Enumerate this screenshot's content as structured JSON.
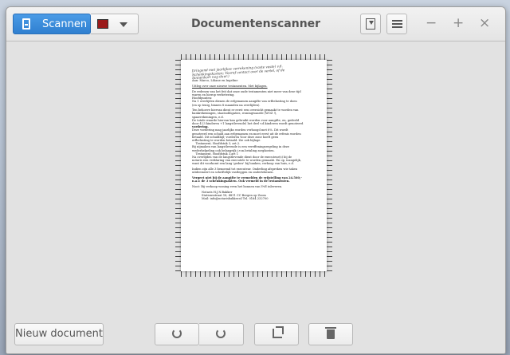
{
  "header": {
    "scan_label": "Scannen",
    "title": "Documentenscanner",
    "minimize": "−",
    "maximize": "+",
    "close": "×"
  },
  "document": {
    "handwritten": [
      "Dringend met jaarlijkse verrekening (vaste vaste) v.d.",
      "Schenkingskosten; Vooraf contact over de vertel, of de",
      "binnenkort nog duur.)"
    ],
    "lines": [
      "Aan: Marco, Liliane en Ingeline",
      "Uitleg over onze nieuwe testamenten. Met bijlagen.",
      "De redenen van het feit dat onze oude testamenten niet meer van deze tijd",
      "waren en hierop verbetering.",
      "Hoofdpunten:",
      "Na 1 overlijden dienen de erfgenamen aangifte van erfbelasting te doen",
      "(en op tenig, binnen 8 maanden na overlijden).",
      "Ten behoeve hiervan dient er eerst een overzicht gemaakt te worden van",
      "bankrekeningen, staatsobligaties, woningwaarde (WOZ !),",
      "spaarrekeningen, e.d.",
      "De totale waarde hiervan kan gebruikt worden voor aangifte, en, gedeeld",
      "door 4 (3 kinderen +1 langstlevende) het deel v.d.kinderen wordt genoteerd",
      "vordering.",
      "Deze vordering mag jaarlijks worden verhoogd met 6%. Dit wordt",
      "genoteerd een schuld aan erfgenamen en moet eerst uit de erfenis worden",
      "betaald. Dit schuldbijl; vorderen Voor deze zone hoeft geen",
      "erfbelasting te worden betaald. Zie ook bijlage.",
      "Testament, Hoofdstuk 3, art.2.",
      "Bij nijmaken van langstlevende is een vereffeningsregeling in deze",
      "wederhelpeling ook belangrijk i.v.m.betaling zorgkosten.",
      "Testament, Hoofdstuk 3,art 1",
      "Na overlijden van de langstlevende dient door de executeur(s) bij de",
      "notaris een verklaring van executele te worden gemaakt. En op, inzagelijk,",
      "want dit voorkomt een lang 'geduw' bij banken, verkoop van huis, e.d.",
      "Indien zijn alle 3 benoemd tot executeur. Onderling afspreken wie taken",
      "uitdeemeert en schriftelijk vastleggen en ondertekenen.",
      "Vergeet niet bij de aangifte te vermelden de vrijstelling van 24.560,-",
      "n.a.v. de 3 schenkingsakten. Ook vermeld in de testamenten.",
      "Noot: Bij verkoop woning even het bonnen van VvE inleveren.",
      "Notaris H.J.N.Bakker",
      "Stationsstraat 18, 4811 CC Bergen op Zoom",
      "Mail: info@notarisbakker.nl     Tel. 0164 232700"
    ]
  },
  "footer": {
    "new_document_label": "Nieuw document"
  },
  "icons": {
    "scan": "document-scan-icon",
    "type": "photo-type-icon",
    "save": "save-icon",
    "menu": "hamburger-menu-icon",
    "rotate_left": "rotate-left-icon",
    "rotate_right": "rotate-right-icon",
    "crop": "crop-icon",
    "delete": "trash-icon"
  },
  "colors": {
    "accent": "#3a8ddd"
  }
}
